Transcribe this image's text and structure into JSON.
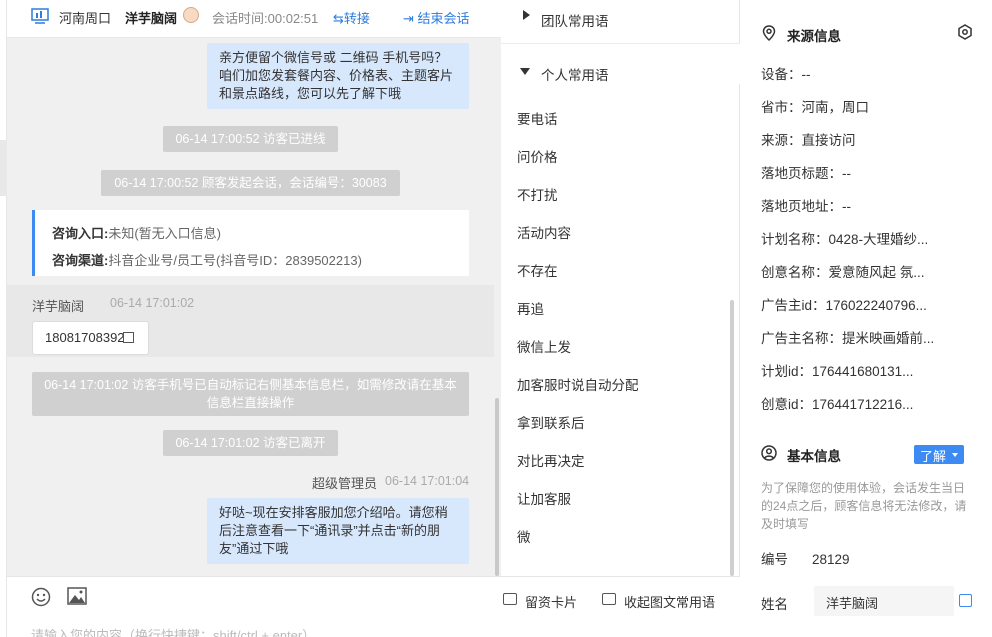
{
  "header": {
    "location": "河南周口",
    "visitor_name": "洋芋脑阔",
    "session_time_label": "会话时间:",
    "session_time": "00:02:51",
    "transfer_label": "转接",
    "end_label": "结束会话"
  },
  "messages": {
    "out1": "亲方便留个微信号或 二维码 手机号吗？咱们加您发套餐内容、价格表、主题客片和景点路线，您可以先了解下哦",
    "sys1": "06-14 17:00:52 访客已进线",
    "sys2": "06-14 17:00:52 顾客发起会话，会话编号：30083",
    "card": {
      "entry_label": "咨询入口:",
      "entry_value": "未知(暂无入口信息)",
      "channel_label": "咨询渠道:",
      "channel_value": "抖音企业号/员工号(抖音号ID：2839502213)"
    },
    "visitor_name": "洋芋脑阔",
    "visitor_time": "06-14 17:01:02",
    "visitor_phone": "18081708392",
    "sys3": "06-14 17:01:02 访客手机号已自动标记右侧基本信息栏，如需修改请在基本信息栏直接操作",
    "sys4": "06-14 17:01:02 访客已离开",
    "admin_name": "超级管理员",
    "admin_time": "06-14 17:01:04",
    "out2": "好哒~现在安排客服加您介绍哈。请您稍后注意查看一下“通讯录”并点击“新的朋友”通过下哦"
  },
  "input": {
    "placeholder": "请输入您的内容（换行快捷键：shift/ctrl + enter）"
  },
  "phrases": {
    "team_label": "团队常用语",
    "personal_label": "个人常用语",
    "items": [
      "要电话",
      "问价格",
      "不打扰",
      "活动内容",
      "不存在",
      "再追",
      "微信上发",
      "加客服时说自动分配",
      "拿到联系后",
      "对比再决定",
      "让加客服",
      "微"
    ],
    "card_btn": "留资卡片",
    "image_btn": "收起图文常用语"
  },
  "source_info": {
    "title": "来源信息",
    "rows": [
      {
        "label": "设备：",
        "value": "--"
      },
      {
        "label": "省市：",
        "value": "河南，周口"
      },
      {
        "label": "来源：",
        "value": "直接访问"
      },
      {
        "label": "落地页标题：",
        "value": "--"
      },
      {
        "label": "落地页地址：",
        "value": "--"
      },
      {
        "label": "计划名称：",
        "value": "0428-大理婚纱..."
      },
      {
        "label": "创意名称：",
        "value": "爱意随风起 氛..."
      },
      {
        "label": "广告主id：",
        "value": "176022240796..."
      },
      {
        "label": "广告主名称：",
        "value": "提米映画婚前..."
      },
      {
        "label": "计划id：",
        "value": "176441680131..."
      },
      {
        "label": "创意id：",
        "value": "176441712216..."
      }
    ]
  },
  "basic_info": {
    "title": "基本信息",
    "learn_more": "了解",
    "notice": "为了保障您的使用体验，会话发生当日的24点之后，顾客信息将无法修改，请及时填写",
    "id_label": "编号",
    "id_value": "28129",
    "name_label": "姓名",
    "name_value": "洋芋脑阔"
  },
  "colors": {
    "accent": "#3d8bf2",
    "bubble_out": "#d7e7fc",
    "system_msg": "#d0d0d0"
  }
}
